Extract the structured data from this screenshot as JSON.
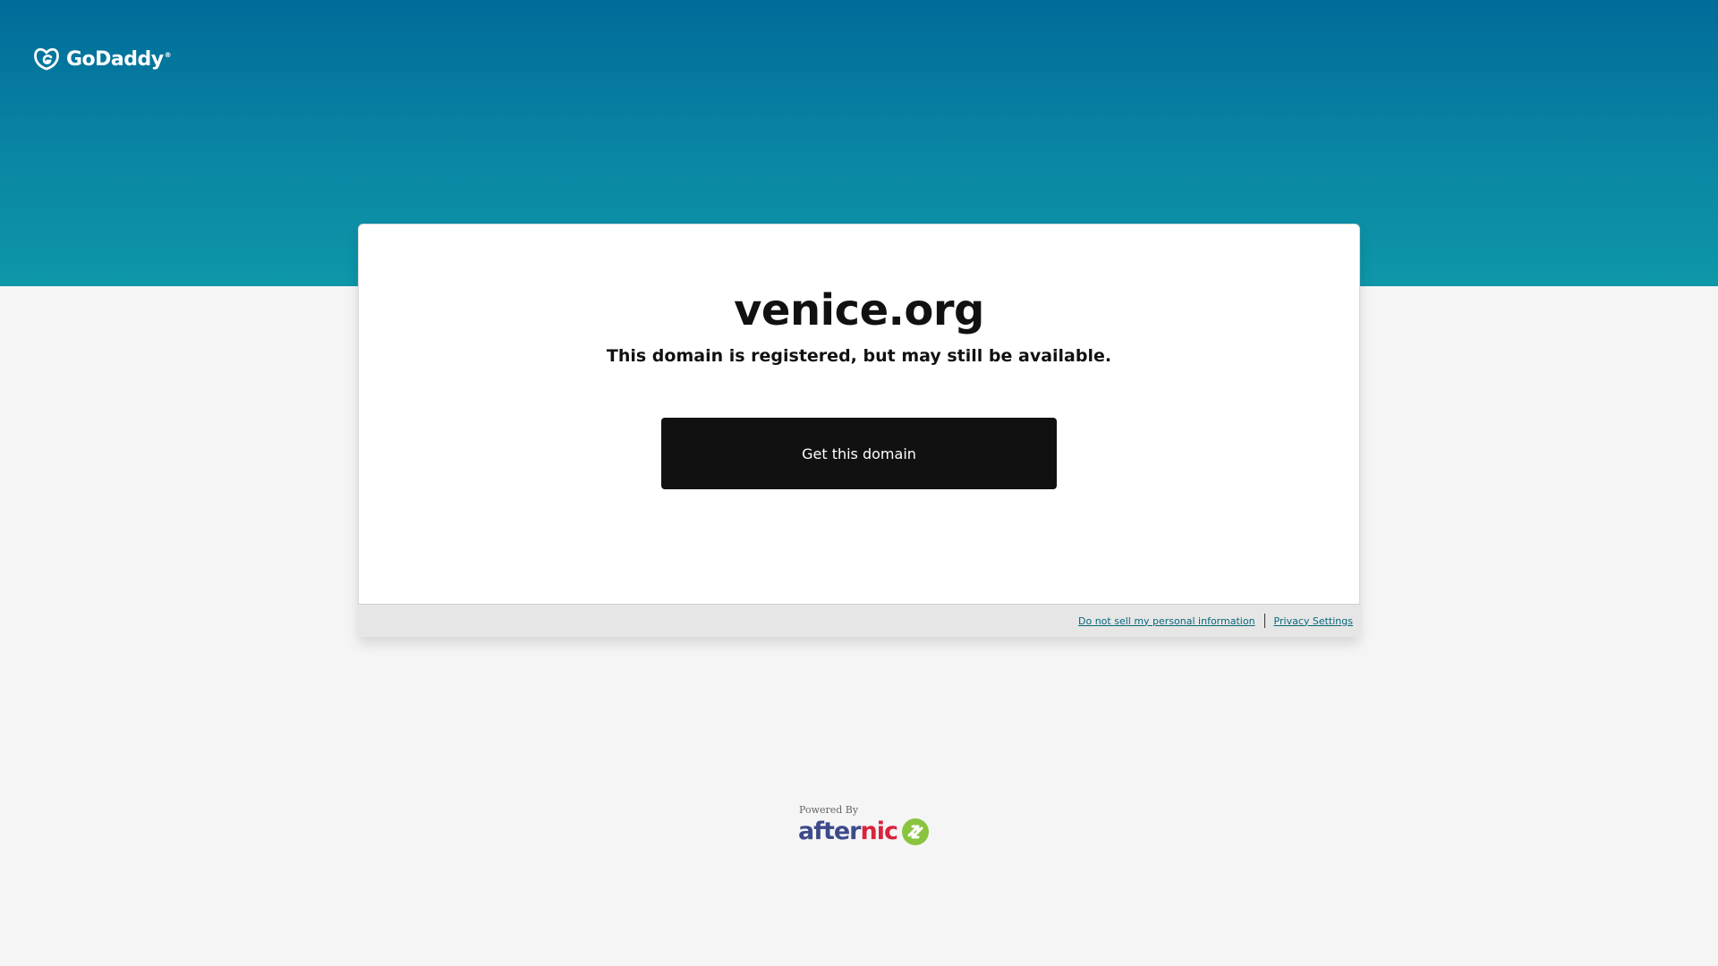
{
  "header": {
    "logo_text": "GoDaddy",
    "logo_icon": "godaddy-logo-icon"
  },
  "card": {
    "domain": "venice.org",
    "subtitle": "This domain is registered, but may still be available.",
    "cta_label": "Get this domain"
  },
  "footer": {
    "links": [
      {
        "label": "Do not sell my personal information"
      },
      {
        "label": "Privacy Settings"
      }
    ]
  },
  "powered_by": {
    "label": "Powered By",
    "brand_part1": "after",
    "brand_part2": "nic",
    "brand_icon": "afternic-arrows-icon"
  },
  "colors": {
    "hero_top": "#006b99",
    "hero_bottom": "#0e97a9",
    "page_bg": "#f5f5f5",
    "cta_bg": "#111111",
    "link": "#08687c",
    "afternic_blue": "#3d4a8a",
    "afternic_red": "#d8233d",
    "afternic_green": "#8ac43f"
  }
}
